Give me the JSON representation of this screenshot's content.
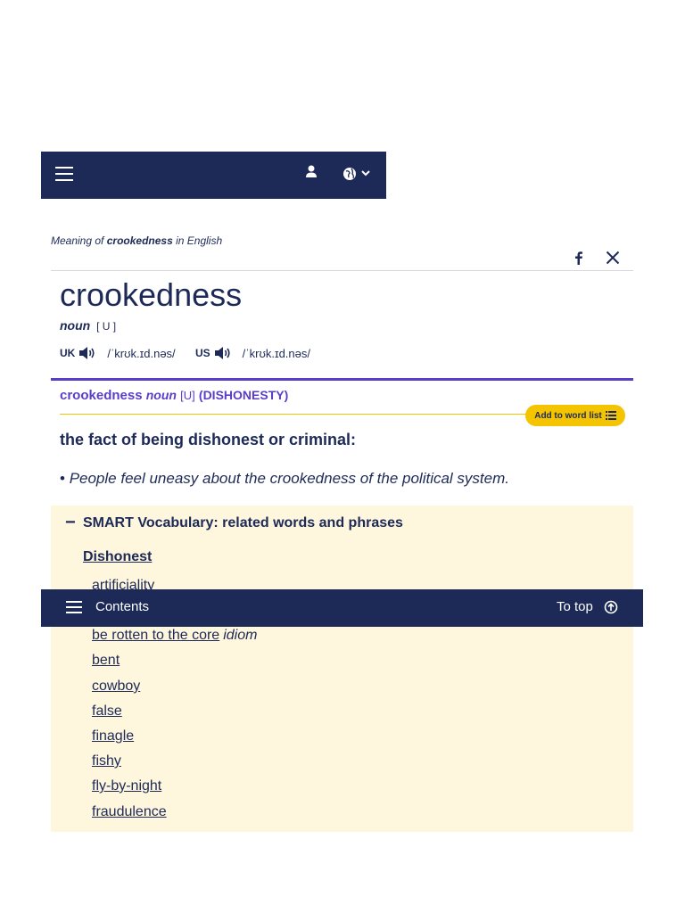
{
  "header": {
    "menu_icon": "hamburger-icon",
    "user_icon": "user-icon",
    "language_icon": "globe-icon"
  },
  "meaning": {
    "prefix": "Meaning of",
    "word": "crookedness",
    "suffix": "in English"
  },
  "share": {
    "facebook_icon": "facebook-icon",
    "x_icon": "x-icon"
  },
  "entry": {
    "headword": "crookedness",
    "pos": "noun",
    "grammar": "[ U ]",
    "pron_uk": {
      "region": "UK",
      "ipa": "/ˈkrʊk.ɪd.nəs/"
    },
    "pron_us": {
      "region": "US",
      "ipa": "/ˈkrʊk.ɪd.nəs/"
    }
  },
  "sense": {
    "headword": "crookedness",
    "pos": "noun",
    "grammar": "[U]",
    "guideword": "(DISHONESTY)",
    "add_to_word_list": "Add to word list",
    "definition": "the fact of being dishonest or criminal:",
    "example_bullet": "•",
    "example": "People feel uneasy about the crookedness of the political system."
  },
  "smart_vocabulary": {
    "toggle": "−",
    "title": "SMART Vocabulary: related words and phrases",
    "category": "Dishonest",
    "items": [
      {
        "word": "artificiality",
        "tag": ""
      },
      {
        "word": "be rotten to the core",
        "tag": "idiom"
      },
      {
        "word": "bent",
        "tag": ""
      },
      {
        "word": "cowboy",
        "tag": ""
      },
      {
        "word": "false",
        "tag": ""
      },
      {
        "word": "finagle",
        "tag": ""
      },
      {
        "word": "fishy",
        "tag": ""
      },
      {
        "word": "fly-by-night",
        "tag": ""
      },
      {
        "word": "fraudulence",
        "tag": ""
      }
    ]
  },
  "contents_bar": {
    "label": "Contents",
    "to_top": "To top"
  },
  "colors": {
    "navy": "#1d2a57",
    "purple": "#5b3ec8",
    "gold": "#f5c400",
    "cream": "#fef6dd"
  }
}
